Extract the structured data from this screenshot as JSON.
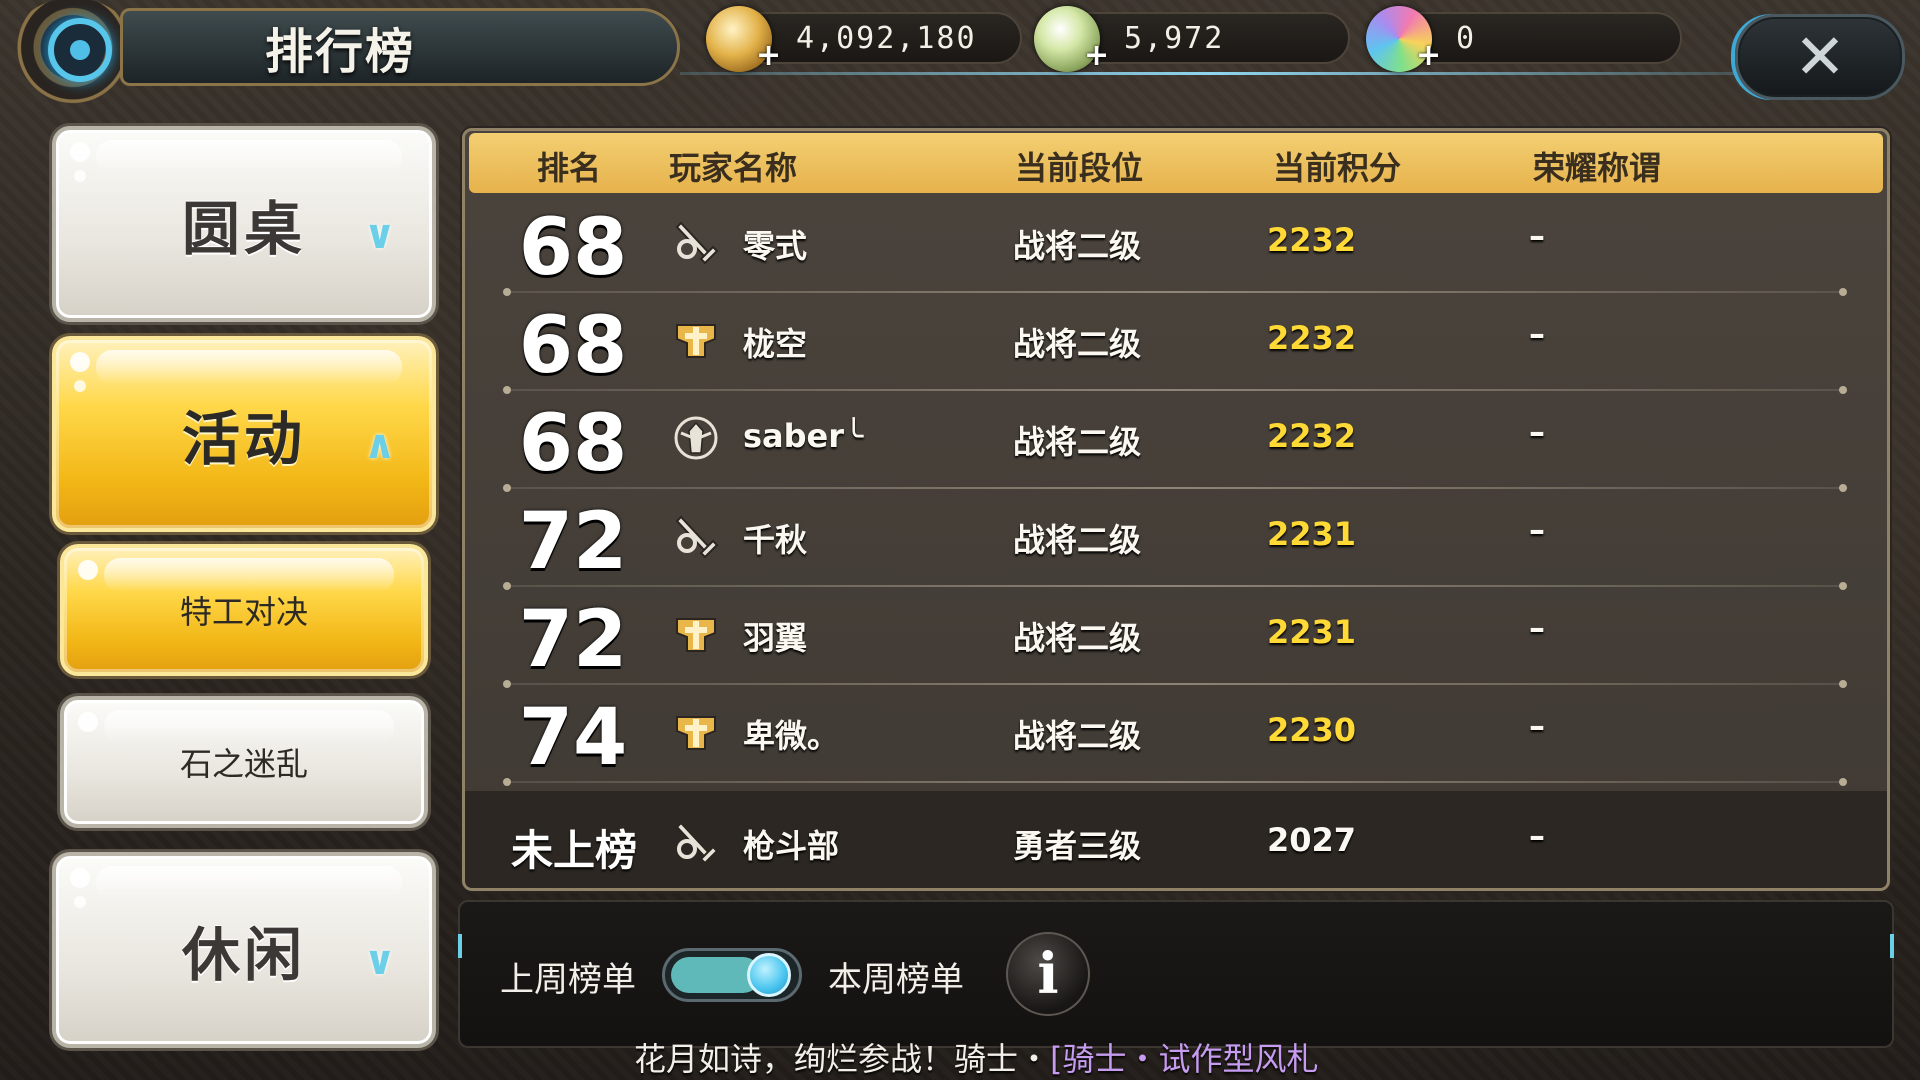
{
  "header": {
    "title": "排行榜",
    "currencies": [
      {
        "icon": "gold-coin-icon",
        "value": "4,092,180",
        "color": "#e3b24a"
      },
      {
        "icon": "crystal-coin-icon",
        "value": "5,972",
        "color": "#b8d88a"
      },
      {
        "icon": "rainbow-gem-icon",
        "value": "0",
        "color": "#9fd6e9"
      }
    ],
    "close_icon": "close-icon",
    "plus_glyph": "+"
  },
  "sidebar": {
    "items": [
      {
        "label": "圆桌",
        "arrow": "∨",
        "state": "collapsed"
      },
      {
        "label": "活动",
        "arrow": "∧",
        "state": "expanded"
      },
      {
        "label": "特工对决",
        "state": "selected"
      },
      {
        "label": "石之迷乱",
        "state": "normal"
      },
      {
        "label": "休闲",
        "arrow": "∨",
        "state": "collapsed"
      }
    ]
  },
  "table": {
    "columns": [
      "排名",
      "玩家名称",
      "当前段位",
      "当前积分",
      "荣耀称谓"
    ],
    "rows": [
      {
        "rank": "68",
        "icon": "sword-class-icon",
        "name": "零式",
        "tier": "战将二级",
        "score": "2232",
        "title": "–"
      },
      {
        "rank": "68",
        "icon": "shield-class-icon",
        "name": "栊空",
        "tier": "战将二级",
        "score": "2232",
        "title": "–"
      },
      {
        "rank": "68",
        "icon": "knight-class-icon",
        "name": "saber╰",
        "tier": "战将二级",
        "score": "2232",
        "title": "–"
      },
      {
        "rank": "72",
        "icon": "sword-class-icon",
        "name": "千秋",
        "tier": "战将二级",
        "score": "2231",
        "title": "–"
      },
      {
        "rank": "72",
        "icon": "shield-class-icon",
        "name": "羽翼",
        "tier": "战将二级",
        "score": "2231",
        "title": "–"
      },
      {
        "rank": "74",
        "icon": "shield-class-icon",
        "name": "卑微。",
        "tier": "战将二级",
        "score": "2230",
        "title": "–"
      }
    ],
    "self": {
      "rank": "未上榜",
      "icon": "sword-class-icon",
      "name": "枪斗部",
      "tier": "勇者三级",
      "score": "2027",
      "title": "–"
    }
  },
  "footer": {
    "last_week_label": "上周榜单",
    "this_week_label": "本周榜单",
    "toggle_state": "this_week",
    "info_glyph": "i",
    "ticker_text": "花月如诗，绚烂参战！骑士・",
    "ticker_highlight": "[骑士・试作型风札"
  }
}
